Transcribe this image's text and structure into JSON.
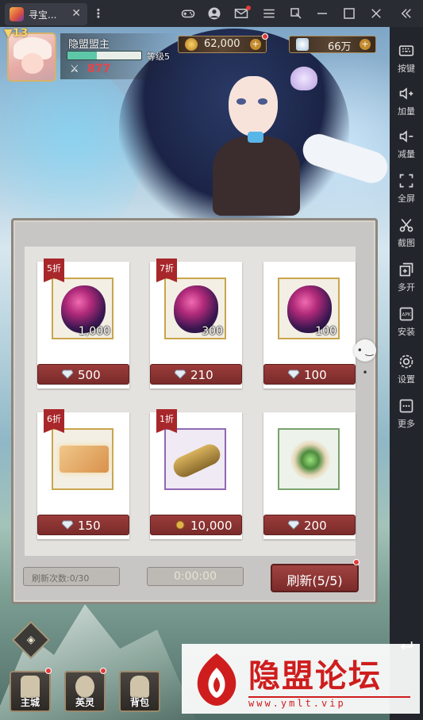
{
  "emulator": {
    "tab_title": "寻宝...",
    "tab_close": "✕",
    "menu_dots": "⋮",
    "top_icons": [
      "gamepad-icon",
      "user-icon",
      "mail-icon",
      "menu-icon",
      "shrink-icon",
      "minimize-icon",
      "maximize-icon",
      "close-icon",
      "collapse-icon"
    ],
    "sidebar": [
      {
        "icon": "keyboard-icon",
        "label": "按键"
      },
      {
        "icon": "volume-up-icon",
        "label": "加量"
      },
      {
        "icon": "volume-down-icon",
        "label": "减量"
      },
      {
        "icon": "fullscreen-icon",
        "label": "全屏"
      },
      {
        "icon": "scissors-icon",
        "label": "截图"
      },
      {
        "icon": "multi-open-icon",
        "label": "多开"
      },
      {
        "icon": "apk-install-icon",
        "label": "安装"
      },
      {
        "icon": "settings-icon",
        "label": "设置"
      },
      {
        "icon": "more-icon",
        "label": "更多"
      }
    ]
  },
  "player": {
    "level": "13",
    "name": "隐盟盟主",
    "rank_label": "等级5",
    "exp_fraction": 0.4,
    "power": "877"
  },
  "resources": {
    "gold": "62,000",
    "diamonds": "66万"
  },
  "shop": {
    "items": [
      {
        "discount": "5折",
        "quantity": "1,000",
        "price": "500",
        "currency": "diamond",
        "item": "red-crystal"
      },
      {
        "discount": "7折",
        "quantity": "300",
        "price": "210",
        "currency": "diamond",
        "item": "red-crystal"
      },
      {
        "discount": "",
        "quantity": "100",
        "price": "100",
        "currency": "diamond",
        "item": "red-crystal"
      },
      {
        "discount": "6折",
        "quantity": "",
        "price": "150",
        "currency": "diamond",
        "item": "gold-ticket"
      },
      {
        "discount": "1折",
        "quantity": "",
        "price": "10,000",
        "currency": "gold",
        "item": "scroll"
      },
      {
        "discount": "",
        "quantity": "",
        "price": "200",
        "currency": "diamond",
        "item": "green-flower"
      }
    ],
    "refresh_count": "刷新次数:0/30",
    "timer": "0:00:00",
    "refresh_button": "刷新(5/5)"
  },
  "bottom_nav": [
    {
      "label": "主城",
      "icon": "city-gate-icon"
    },
    {
      "label": "英灵",
      "icon": "hero-helmet-icon"
    },
    {
      "label": "背包",
      "icon": "backpack-icon"
    }
  ],
  "watermark": {
    "title": "隐盟论坛",
    "url": "www.ymlt.vip"
  },
  "colors": {
    "price_bar": "#8a3331",
    "panel_bg": "#c8c6c4",
    "accent_gold": "#c9a54d",
    "watermark_red": "#cf1d1d"
  }
}
